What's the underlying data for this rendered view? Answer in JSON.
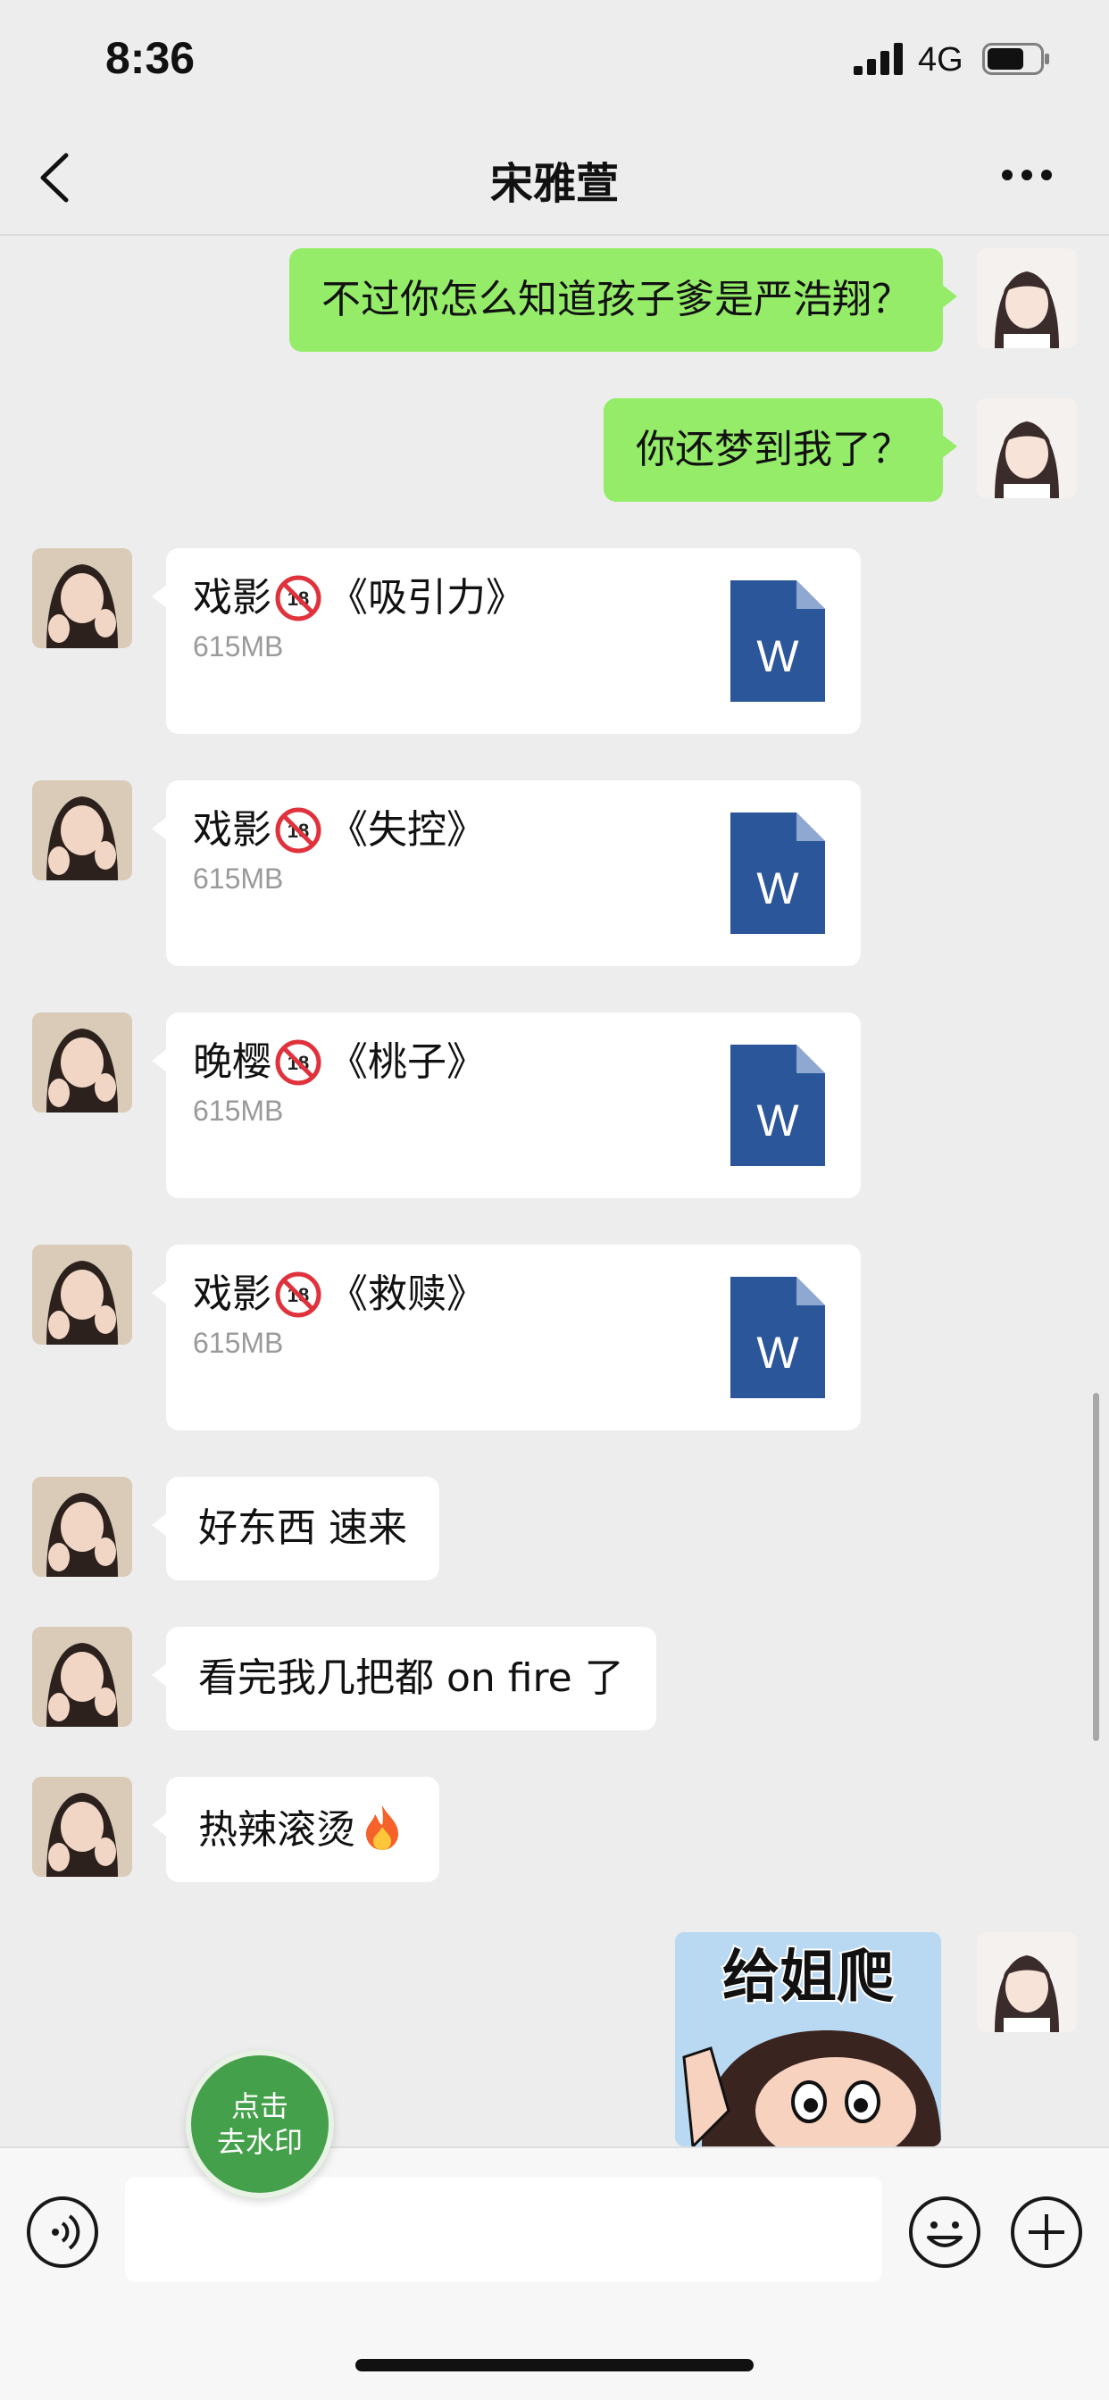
{
  "status_bar": {
    "time": "8:36",
    "network": "4G"
  },
  "header": {
    "title": "宋雅萱"
  },
  "messages": [
    {
      "type": "text",
      "side": "sent",
      "text": "不过你怎么知道孩子爹是严浩翔？"
    },
    {
      "type": "text",
      "side": "sent",
      "text": "你还梦到我了？"
    },
    {
      "type": "file",
      "side": "received",
      "name_prefix": "戏影",
      "name_title": "《吸引力》",
      "size": "615MB",
      "badge": "18"
    },
    {
      "type": "file",
      "side": "received",
      "name_prefix": "戏影",
      "name_title": "《失控》",
      "size": "615MB",
      "badge": "18"
    },
    {
      "type": "file",
      "side": "received",
      "name_prefix": "晚樱",
      "name_title": "《桃子》",
      "size": "615MB",
      "badge": "18"
    },
    {
      "type": "file",
      "side": "received",
      "name_prefix": "戏影",
      "name_title": "《救赎》",
      "size": "615MB",
      "badge": "18"
    },
    {
      "type": "text",
      "side": "received",
      "text": "好东西 速来"
    },
    {
      "type": "text",
      "side": "received",
      "text": "看完我几把都 on fire 了"
    },
    {
      "type": "text",
      "side": "received",
      "text": "热辣滚烫",
      "emoji": "fire-icon"
    },
    {
      "type": "sticker",
      "side": "sent",
      "text": "给姐爬"
    }
  ],
  "file_icon_letter": "W",
  "watermark_button": {
    "line1": "点击",
    "line2": "去水印"
  },
  "input": {
    "value": "",
    "placeholder": ""
  },
  "colors": {
    "sent_bubble": "#95ec69",
    "received_bubble": "#ffffff",
    "background": "#ededed",
    "word_icon": "#2b579a",
    "watermark_button": "#44a04a"
  }
}
